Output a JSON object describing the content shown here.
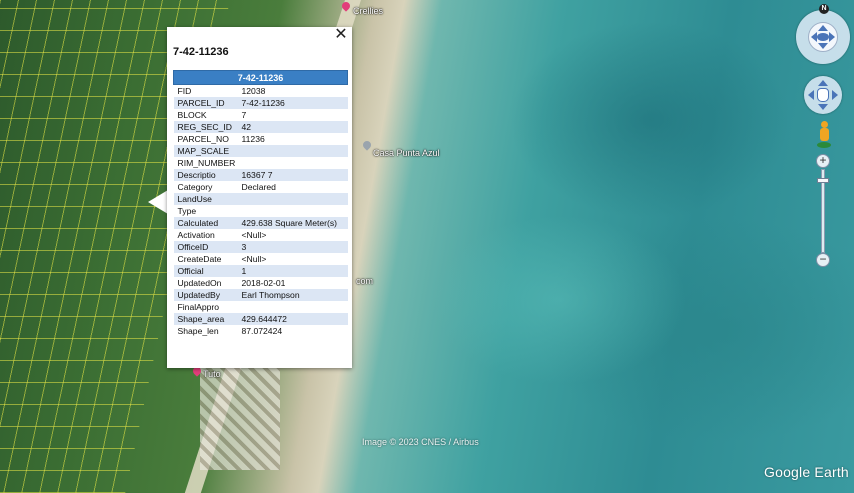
{
  "map": {
    "labels": {
      "place_top": "Crellies",
      "place_mid": "Casa Punta Azul",
      "place_com": "com",
      "place_bottom": "Tuto"
    },
    "attribution": "Image © 2023 CNES / Airbus",
    "brand": "Google Earth"
  },
  "popup": {
    "title": "7-42-11236",
    "close_symbol": "✕",
    "table_header": "7-42-11236",
    "rows": [
      {
        "key": "FID",
        "value": "12038"
      },
      {
        "key": "PARCEL_ID",
        "value": "7-42-11236"
      },
      {
        "key": "BLOCK",
        "value": "7"
      },
      {
        "key": "REG_SEC_ID",
        "value": "42"
      },
      {
        "key": "PARCEL_NO",
        "value": "11236"
      },
      {
        "key": "MAP_SCALE",
        "value": ""
      },
      {
        "key": "RIM_NUMBER",
        "value": ""
      },
      {
        "key": "Descriptio",
        "value": "16367 7"
      },
      {
        "key": "Category",
        "value": "Declared"
      },
      {
        "key": "LandUse",
        "value": ""
      },
      {
        "key": "Type",
        "value": ""
      },
      {
        "key": "Calculated",
        "value": "429.638 Square Meter(s)"
      },
      {
        "key": "Activation",
        "value": "<Null>"
      },
      {
        "key": "OfficeID",
        "value": "3"
      },
      {
        "key": "CreateDate",
        "value": "<Null>"
      },
      {
        "key": "Official",
        "value": "1"
      },
      {
        "key": "UpdatedOn",
        "value": "2018-02-01"
      },
      {
        "key": "UpdatedBy",
        "value": "Earl Thompson"
      },
      {
        "key": "FinalAppro",
        "value": ""
      },
      {
        "key": "Shape_area",
        "value": "429.644472"
      },
      {
        "key": "Shape_len",
        "value": "87.072424"
      }
    ]
  },
  "controls": {
    "compass_letter": "N",
    "zoom_in": "+",
    "zoom_out": "−",
    "zoom_level": 0.12
  },
  "colors": {
    "table_header_bg": "#3a7fc4",
    "row_alt_bg": "#dce6f4",
    "pin_pink": "#e23d7a",
    "pin_grey": "#9aa4ad"
  },
  "icons": [
    "compass-icon",
    "pan-hand-icon",
    "pegman-icon",
    "zoom-in-icon",
    "zoom-out-icon",
    "close-icon",
    "place-pin-icon"
  ]
}
